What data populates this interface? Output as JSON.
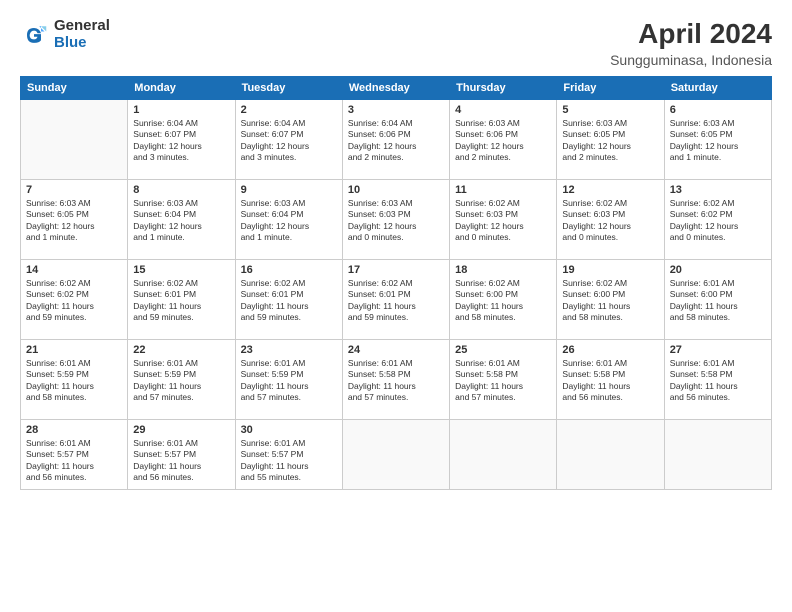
{
  "logo": {
    "general": "General",
    "blue": "Blue"
  },
  "header": {
    "title": "April 2024",
    "subtitle": "Sungguminasa, Indonesia"
  },
  "weekdays": [
    "Sunday",
    "Monday",
    "Tuesday",
    "Wednesday",
    "Thursday",
    "Friday",
    "Saturday"
  ],
  "weeks": [
    [
      {
        "day": "",
        "info": ""
      },
      {
        "day": "1",
        "info": "Sunrise: 6:04 AM\nSunset: 6:07 PM\nDaylight: 12 hours\nand 3 minutes."
      },
      {
        "day": "2",
        "info": "Sunrise: 6:04 AM\nSunset: 6:07 PM\nDaylight: 12 hours\nand 3 minutes."
      },
      {
        "day": "3",
        "info": "Sunrise: 6:04 AM\nSunset: 6:06 PM\nDaylight: 12 hours\nand 2 minutes."
      },
      {
        "day": "4",
        "info": "Sunrise: 6:03 AM\nSunset: 6:06 PM\nDaylight: 12 hours\nand 2 minutes."
      },
      {
        "day": "5",
        "info": "Sunrise: 6:03 AM\nSunset: 6:05 PM\nDaylight: 12 hours\nand 2 minutes."
      },
      {
        "day": "6",
        "info": "Sunrise: 6:03 AM\nSunset: 6:05 PM\nDaylight: 12 hours\nand 1 minute."
      }
    ],
    [
      {
        "day": "7",
        "info": "Sunrise: 6:03 AM\nSunset: 6:05 PM\nDaylight: 12 hours\nand 1 minute."
      },
      {
        "day": "8",
        "info": "Sunrise: 6:03 AM\nSunset: 6:04 PM\nDaylight: 12 hours\nand 1 minute."
      },
      {
        "day": "9",
        "info": "Sunrise: 6:03 AM\nSunset: 6:04 PM\nDaylight: 12 hours\nand 1 minute."
      },
      {
        "day": "10",
        "info": "Sunrise: 6:03 AM\nSunset: 6:03 PM\nDaylight: 12 hours\nand 0 minutes."
      },
      {
        "day": "11",
        "info": "Sunrise: 6:02 AM\nSunset: 6:03 PM\nDaylight: 12 hours\nand 0 minutes."
      },
      {
        "day": "12",
        "info": "Sunrise: 6:02 AM\nSunset: 6:03 PM\nDaylight: 12 hours\nand 0 minutes."
      },
      {
        "day": "13",
        "info": "Sunrise: 6:02 AM\nSunset: 6:02 PM\nDaylight: 12 hours\nand 0 minutes."
      }
    ],
    [
      {
        "day": "14",
        "info": "Sunrise: 6:02 AM\nSunset: 6:02 PM\nDaylight: 11 hours\nand 59 minutes."
      },
      {
        "day": "15",
        "info": "Sunrise: 6:02 AM\nSunset: 6:01 PM\nDaylight: 11 hours\nand 59 minutes."
      },
      {
        "day": "16",
        "info": "Sunrise: 6:02 AM\nSunset: 6:01 PM\nDaylight: 11 hours\nand 59 minutes."
      },
      {
        "day": "17",
        "info": "Sunrise: 6:02 AM\nSunset: 6:01 PM\nDaylight: 11 hours\nand 59 minutes."
      },
      {
        "day": "18",
        "info": "Sunrise: 6:02 AM\nSunset: 6:00 PM\nDaylight: 11 hours\nand 58 minutes."
      },
      {
        "day": "19",
        "info": "Sunrise: 6:02 AM\nSunset: 6:00 PM\nDaylight: 11 hours\nand 58 minutes."
      },
      {
        "day": "20",
        "info": "Sunrise: 6:01 AM\nSunset: 6:00 PM\nDaylight: 11 hours\nand 58 minutes."
      }
    ],
    [
      {
        "day": "21",
        "info": "Sunrise: 6:01 AM\nSunset: 5:59 PM\nDaylight: 11 hours\nand 58 minutes."
      },
      {
        "day": "22",
        "info": "Sunrise: 6:01 AM\nSunset: 5:59 PM\nDaylight: 11 hours\nand 57 minutes."
      },
      {
        "day": "23",
        "info": "Sunrise: 6:01 AM\nSunset: 5:59 PM\nDaylight: 11 hours\nand 57 minutes."
      },
      {
        "day": "24",
        "info": "Sunrise: 6:01 AM\nSunset: 5:58 PM\nDaylight: 11 hours\nand 57 minutes."
      },
      {
        "day": "25",
        "info": "Sunrise: 6:01 AM\nSunset: 5:58 PM\nDaylight: 11 hours\nand 57 minutes."
      },
      {
        "day": "26",
        "info": "Sunrise: 6:01 AM\nSunset: 5:58 PM\nDaylight: 11 hours\nand 56 minutes."
      },
      {
        "day": "27",
        "info": "Sunrise: 6:01 AM\nSunset: 5:58 PM\nDaylight: 11 hours\nand 56 minutes."
      }
    ],
    [
      {
        "day": "28",
        "info": "Sunrise: 6:01 AM\nSunset: 5:57 PM\nDaylight: 11 hours\nand 56 minutes."
      },
      {
        "day": "29",
        "info": "Sunrise: 6:01 AM\nSunset: 5:57 PM\nDaylight: 11 hours\nand 56 minutes."
      },
      {
        "day": "30",
        "info": "Sunrise: 6:01 AM\nSunset: 5:57 PM\nDaylight: 11 hours\nand 55 minutes."
      },
      {
        "day": "",
        "info": ""
      },
      {
        "day": "",
        "info": ""
      },
      {
        "day": "",
        "info": ""
      },
      {
        "day": "",
        "info": ""
      }
    ]
  ]
}
